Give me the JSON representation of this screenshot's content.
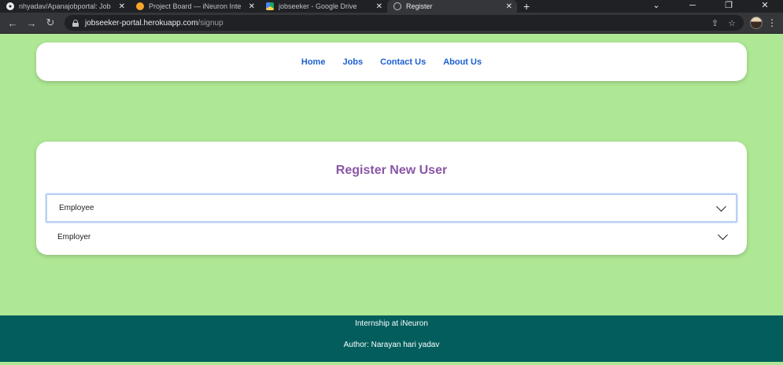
{
  "browser": {
    "tabs": [
      {
        "title": "nhyadav/Apanajobportal: Jobsee",
        "icon": "github-icon",
        "active": false
      },
      {
        "title": "Project Board — iNeuron Interns",
        "icon": "ineuron-icon",
        "active": false
      },
      {
        "title": "jobseeker - Google Drive",
        "icon": "google-drive-icon",
        "active": false
      },
      {
        "title": "Register",
        "icon": "globe-icon",
        "active": true
      }
    ],
    "new_tab_label": "+",
    "url_host": "jobseeker-portal.herokuapp.com",
    "url_path": "/signup"
  },
  "nav": {
    "links": [
      "Home",
      "Jobs",
      "Contact Us",
      "About Us"
    ],
    "link_color": "#1a5fd0"
  },
  "register": {
    "title": "Register New User",
    "title_color": "#8a56a6",
    "options": [
      "Employee",
      "Employer"
    ]
  },
  "footer": {
    "line1": "Internship at iNeuron",
    "line2": "Author: Narayan hari yadav",
    "background": "#035d5d"
  },
  "page_background": "#aee895"
}
